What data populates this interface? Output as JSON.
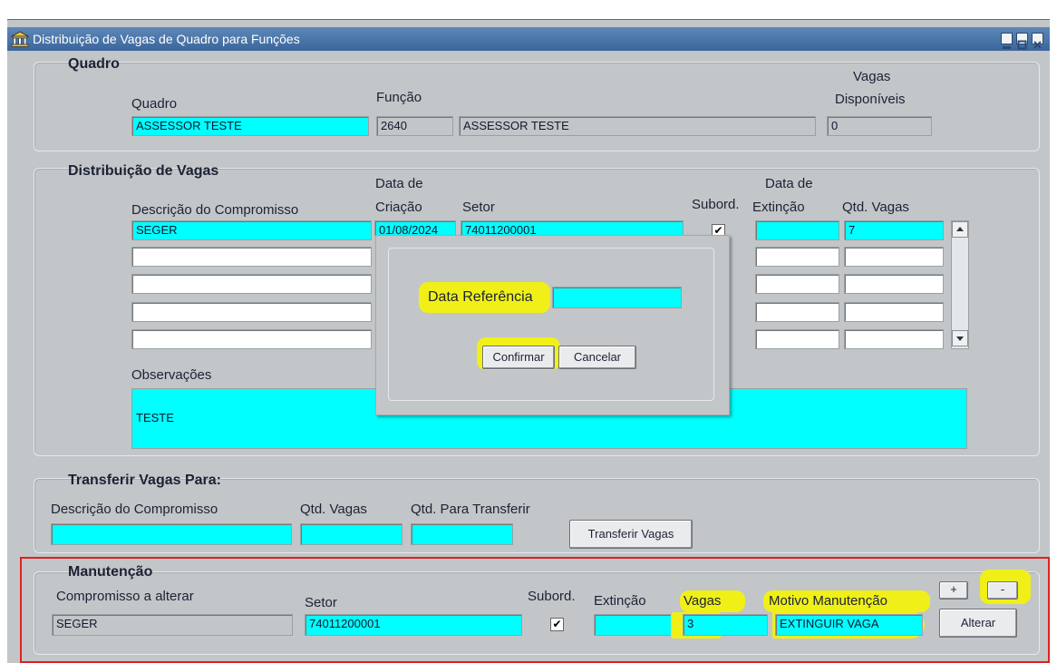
{
  "window": {
    "title": "Distribuição de Vagas de Quadro para Funções"
  },
  "quadro": {
    "group_title": "Quadro",
    "quadro_label": "Quadro",
    "funcao_label": "Função",
    "vagas_label_1": "Vagas",
    "vagas_label_2": "Disponíveis",
    "quadro_value": "ASSESSOR TESTE",
    "funcao_code": "2640",
    "funcao_name": "ASSESSOR TESTE",
    "vagas_value": "0"
  },
  "distribuicao": {
    "group_title": "Distribuição de Vagas",
    "col_descricao": "Descrição do Compromisso",
    "col_data_criacao_1": "Data de",
    "col_data_criacao_2": "Criação",
    "col_setor": "Setor",
    "col_subord": "Subord.",
    "col_data_ext_1": "Data de",
    "col_data_ext_2": "Extinção",
    "col_qtd": "Qtd. Vagas",
    "row1": {
      "descricao": "SEGER",
      "data": "01/08/2024",
      "setor": "74011200001",
      "subord": "✔",
      "qtd": "7"
    },
    "observacoes_label": "Observações",
    "observacoes_value": "TESTE"
  },
  "dialog": {
    "label": "Data Referência",
    "confirm": "Confirmar",
    "cancel": "Cancelar"
  },
  "transferir": {
    "group_title": "Transferir Vagas Para:",
    "col_descricao": "Descrição do Compromisso",
    "col_qtd": "Qtd. Vagas",
    "col_qtd_transf": "Qtd. Para Transferir",
    "button": "Transferir Vagas"
  },
  "manutencao": {
    "group_title": "Manutenção",
    "compromisso_label": "Compromisso a alterar",
    "setor_label": "Setor",
    "subord_label": "Subord.",
    "extincao_label": "Extinção",
    "vagas_label": "Vagas",
    "motivo_label": "Motivo Manutenção",
    "compromisso_value": "SEGER",
    "setor_value": "74011200001",
    "subord_value": "✔",
    "vagas_value": "3",
    "motivo_value": "EXTINGUIR VAGA",
    "plus": "+",
    "minus": "-",
    "alterar": "Alterar"
  }
}
